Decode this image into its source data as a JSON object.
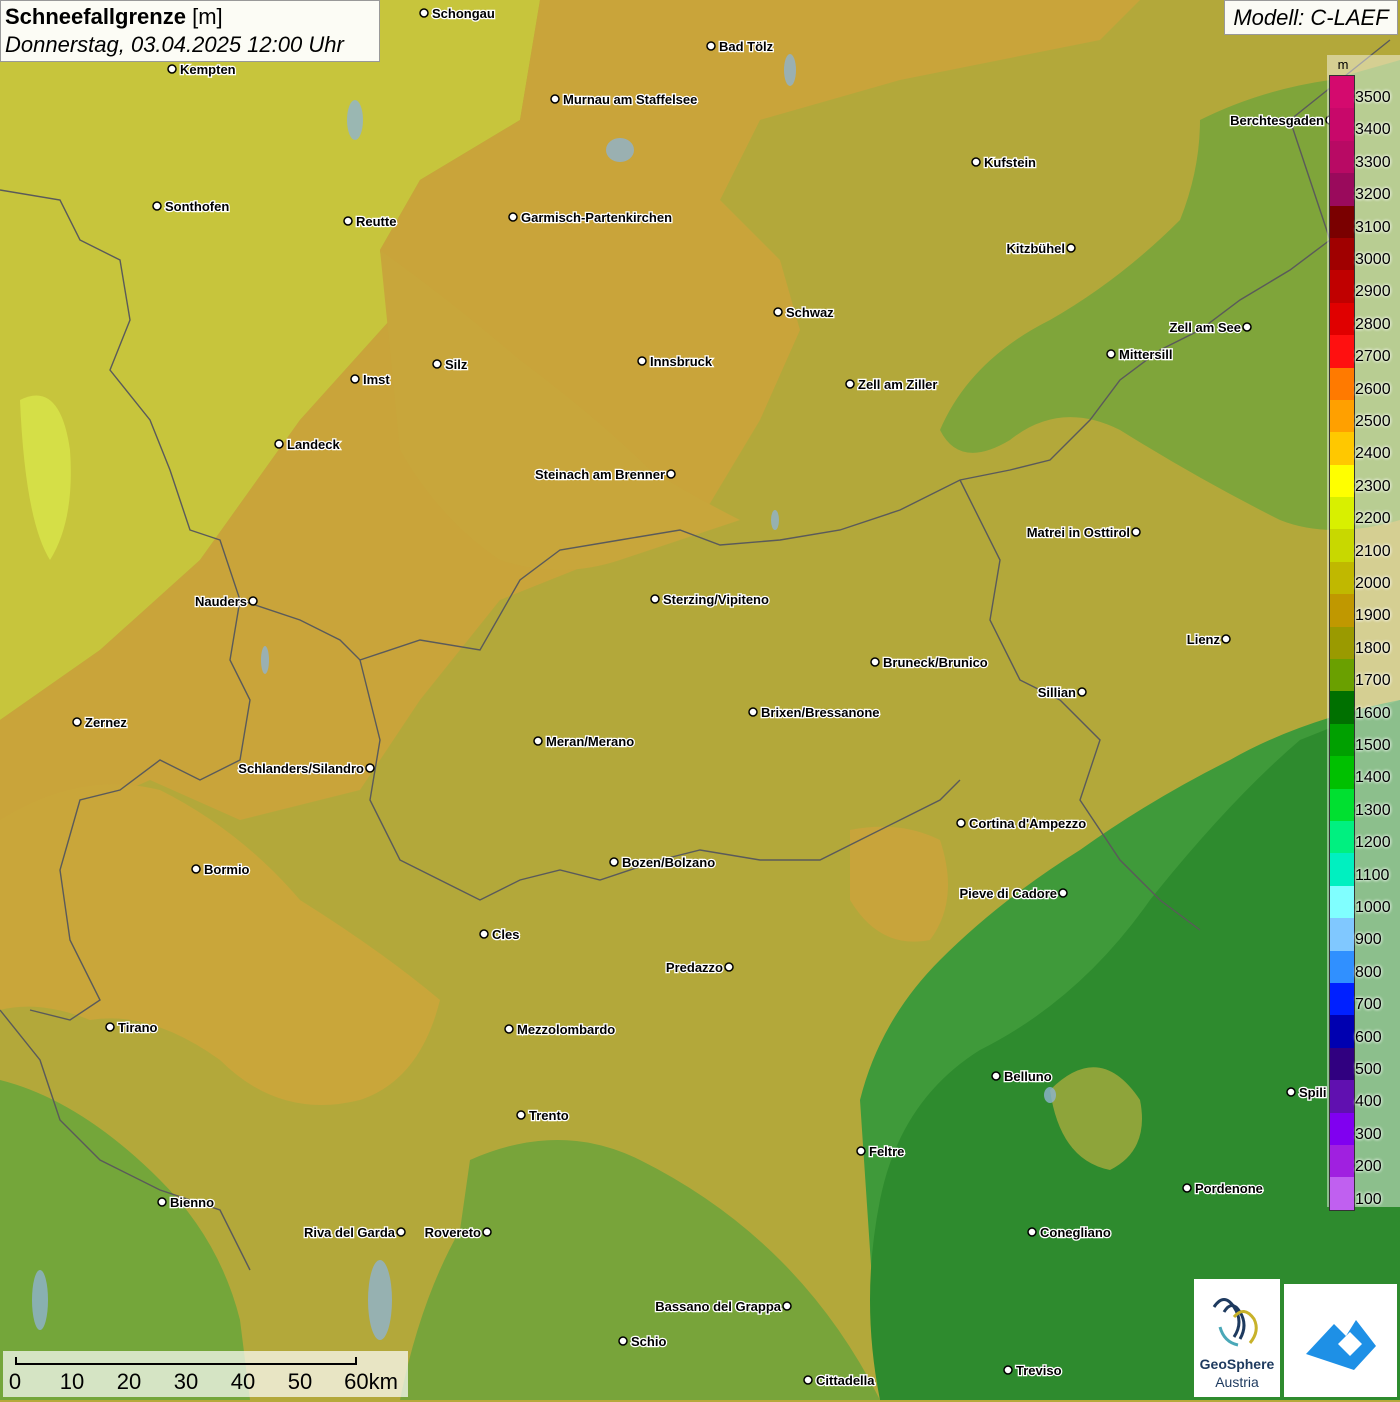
{
  "title": {
    "main": "Schneefallgrenze",
    "unit": "[m]",
    "datetime": "Donnerstag, 03.04.2025 12:00 Uhr"
  },
  "model": "Modell: C-LAEF",
  "legend": {
    "unit": "m",
    "entries": [
      {
        "label": "3500",
        "color": "#d40a6e"
      },
      {
        "label": "3400",
        "color": "#c8086a"
      },
      {
        "label": "3300",
        "color": "#b80a64"
      },
      {
        "label": "3200",
        "color": "#9a0a5c"
      },
      {
        "label": "3100",
        "color": "#7a0000"
      },
      {
        "label": "3000",
        "color": "#a00000"
      },
      {
        "label": "2900",
        "color": "#c00000"
      },
      {
        "label": "2800",
        "color": "#e00000"
      },
      {
        "label": "2700",
        "color": "#ff1010"
      },
      {
        "label": "2600",
        "color": "#ff7a00"
      },
      {
        "label": "2500",
        "color": "#ffa000"
      },
      {
        "label": "2400",
        "color": "#ffc800"
      },
      {
        "label": "2300",
        "color": "#ffff00"
      },
      {
        "label": "2200",
        "color": "#d8f000"
      },
      {
        "label": "2100",
        "color": "#c8d800"
      },
      {
        "label": "2000",
        "color": "#c0b800"
      },
      {
        "label": "1900",
        "color": "#c09800"
      },
      {
        "label": "1800",
        "color": "#9a9a00"
      },
      {
        "label": "1700",
        "color": "#6aa000"
      },
      {
        "label": "1600",
        "color": "#007000"
      },
      {
        "label": "1500",
        "color": "#00a000"
      },
      {
        "label": "1400",
        "color": "#00c000"
      },
      {
        "label": "1300",
        "color": "#00e030"
      },
      {
        "label": "1200",
        "color": "#00f080"
      },
      {
        "label": "1100",
        "color": "#00f0c0"
      },
      {
        "label": "1000",
        "color": "#80ffff"
      },
      {
        "label": "900",
        "color": "#80c8ff"
      },
      {
        "label": "800",
        "color": "#3090ff"
      },
      {
        "label": "700",
        "color": "#0020ff"
      },
      {
        "label": "600",
        "color": "#0000b0"
      },
      {
        "label": "500",
        "color": "#300080"
      },
      {
        "label": "400",
        "color": "#6010b0"
      },
      {
        "label": "300",
        "color": "#8000f0"
      },
      {
        "label": "200",
        "color": "#a020e0"
      },
      {
        "label": "100",
        "color": "#c060f0"
      }
    ]
  },
  "scale": {
    "labels": [
      "0",
      "10",
      "20",
      "30",
      "40",
      "50",
      "60km"
    ]
  },
  "logo": {
    "name": "GeoSphere",
    "country": "Austria"
  },
  "cities": [
    {
      "name": "Schongau"
    },
    {
      "name": "Bad Tölz"
    },
    {
      "name": "Kempten"
    },
    {
      "name": "Murnau am Staffelsee"
    },
    {
      "name": "Berchtesgaden"
    },
    {
      "name": "Kufstein"
    },
    {
      "name": "Sonthofen"
    },
    {
      "name": "Reutte"
    },
    {
      "name": "Garmisch-Partenkirchen"
    },
    {
      "name": "Kitzbühel"
    },
    {
      "name": "Schwaz"
    },
    {
      "name": "Zell am See"
    },
    {
      "name": "Innsbruck"
    },
    {
      "name": "Silz"
    },
    {
      "name": "Mittersill"
    },
    {
      "name": "Imst"
    },
    {
      "name": "Zell am Ziller"
    },
    {
      "name": "Landeck"
    },
    {
      "name": "Steinach am Brenner"
    },
    {
      "name": "Matrei in Osttirol"
    },
    {
      "name": "Nauders"
    },
    {
      "name": "Sterzing/Vipiteno"
    },
    {
      "name": "Lienz"
    },
    {
      "name": "Bruneck/Brunico"
    },
    {
      "name": "Sillian"
    },
    {
      "name": "Brixen/Bressanone"
    },
    {
      "name": "Zernez"
    },
    {
      "name": "Meran/Merano"
    },
    {
      "name": "Schlanders/Silandro"
    },
    {
      "name": "Cortina d'Ampezzo"
    },
    {
      "name": "Bozen/Bolzano"
    },
    {
      "name": "Bormio"
    },
    {
      "name": "Pieve di Cadore"
    },
    {
      "name": "Cles"
    },
    {
      "name": "Predazzo"
    },
    {
      "name": "Tirano"
    },
    {
      "name": "Mezzolombardo"
    },
    {
      "name": "Belluno"
    },
    {
      "name": "Spili"
    },
    {
      "name": "Trento"
    },
    {
      "name": "Feltre"
    },
    {
      "name": "Pordenone"
    },
    {
      "name": "Bienno"
    },
    {
      "name": "Riva del Garda"
    },
    {
      "name": "Rovereto"
    },
    {
      "name": "Conegliano"
    },
    {
      "name": "Bassano del Grappa"
    },
    {
      "name": "Schio"
    },
    {
      "name": "Treviso"
    },
    {
      "name": "Cittadella"
    }
  ]
}
